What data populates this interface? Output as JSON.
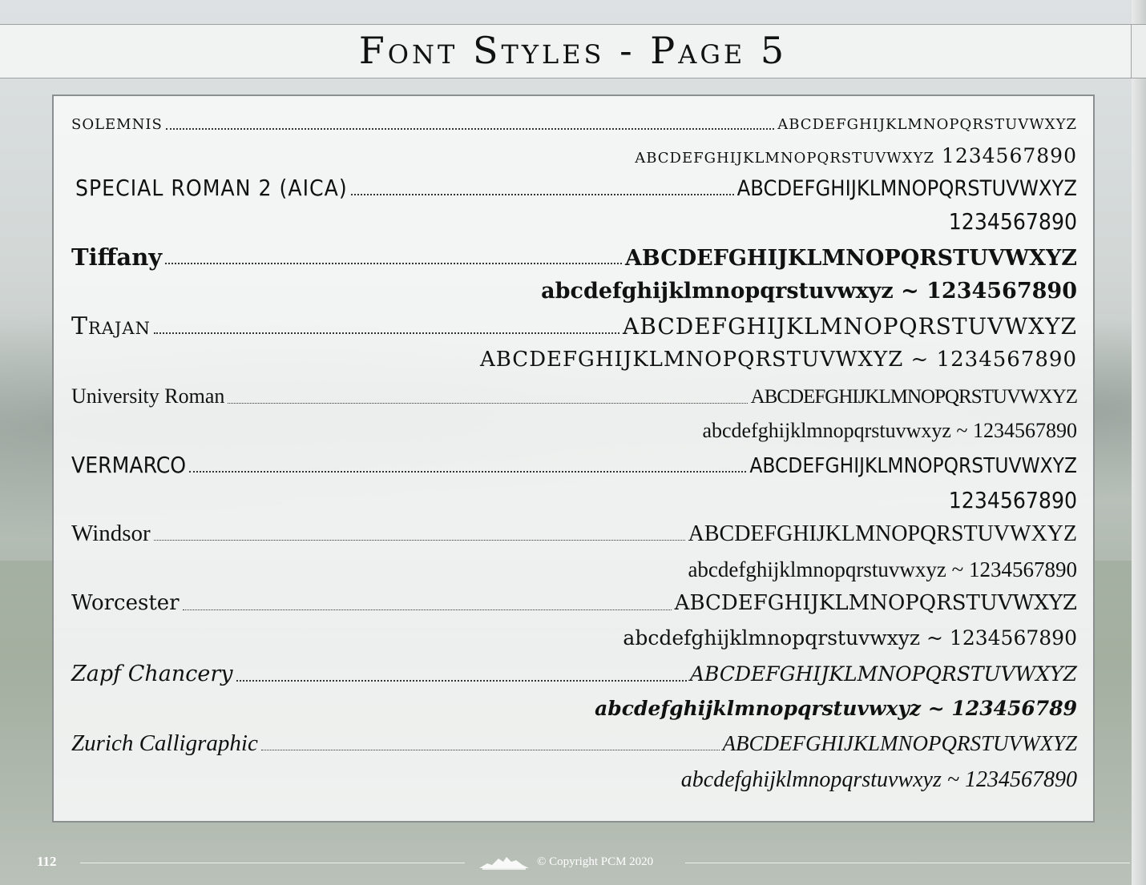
{
  "title": "Font Styles - Page 5",
  "fonts": [
    {
      "name": "solemnis",
      "upper": "abcdefghijklmnopqrstuvwxyz",
      "second": "abcdefghijklmnopqrstuvwxyz 1234567890"
    },
    {
      "name": "SPECIAL ROMAN 2 (AICA)",
      "upper": "ABCDEFGHIJKLMNOPQRSTUVWXYZ",
      "second": "1234567890"
    },
    {
      "name": "Tiffany",
      "upper": "ABCDEFGHIJKLMNOPQRSTUVWXYZ",
      "second": "abcdefghijklmnopqrstuvwxyz ~ 1234567890"
    },
    {
      "name": "Trajan",
      "upper": "ABCDEFGHIJKLMNOPQRSTUVWXYZ",
      "second": "ABCDEFGHIJKLMNOPQRSTUVWXYZ ~ 1234567890"
    },
    {
      "name": "University Roman",
      "upper": "ABCDEFGHIJKLMNOPQRSTUVWXYZ",
      "second": "abcdefghijklmnopqrstuvwxyz ~ 1234567890"
    },
    {
      "name": "VERMARCO",
      "upper": "ABCDEFGHIJKLMNOPQRSTUVWXYZ",
      "second": "1234567890"
    },
    {
      "name": "Windsor",
      "upper": "ABCDEFGHIJKLMNOPQRSTUVWXYZ",
      "second": "abcdefghijklmnopqrstuvwxyz ~ 1234567890"
    },
    {
      "name": "Worcester",
      "upper": "ABCDEFGHIJKLMNOPQRSTUVWXYZ",
      "second": "abcdefghijklmnopqrstuvwxyz ~ 1234567890"
    },
    {
      "name": "Zapf Chancery",
      "upper": "ABCDEFGHIJKLMNOPQRSTUVWXYZ",
      "second": "abcdefghijklmnopqrstuvwxyz ~ 123456789"
    },
    {
      "name": "Zurich Calligraphic",
      "upper": "ABCDEFGHIJKLMNOPQRSTUVWXYZ",
      "second": "abcdefghijklmnopqrstuvwxyz ~ 1234567890"
    }
  ],
  "footer": {
    "page_number": "112",
    "copyright": "© Copyright PCM 2020",
    "logo_icon": "mountain-icon"
  }
}
